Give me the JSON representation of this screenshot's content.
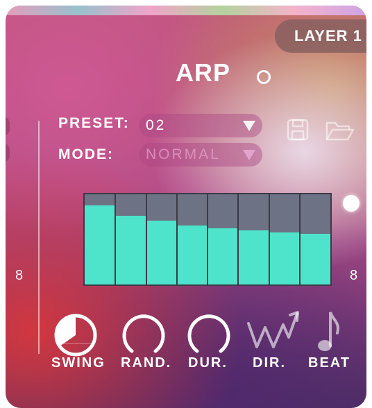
{
  "header": {
    "layer_label": "LAYER 1"
  },
  "arp": {
    "title": "ARP"
  },
  "preset": {
    "label": "PRESET:",
    "value": "02"
  },
  "mode": {
    "label": "MODE:",
    "value": "NORMAL"
  },
  "step_sequencer": {
    "steps": [
      0.88,
      0.76,
      0.71,
      0.65,
      0.62,
      0.6,
      0.58,
      0.56
    ],
    "left_count": "8",
    "right_count": "8"
  },
  "controls": {
    "swing": "SWING",
    "rand": "RAND.",
    "dur": "DUR.",
    "dir": "DIR.",
    "beat": "BEAT"
  },
  "colors": {
    "bar": "#4ee4cb",
    "accent": "#ffffff"
  },
  "icons": {
    "save": "save-icon",
    "open": "folder-icon",
    "dir": "zigzag-arrow-icon",
    "beat": "eighth-note-icon"
  }
}
